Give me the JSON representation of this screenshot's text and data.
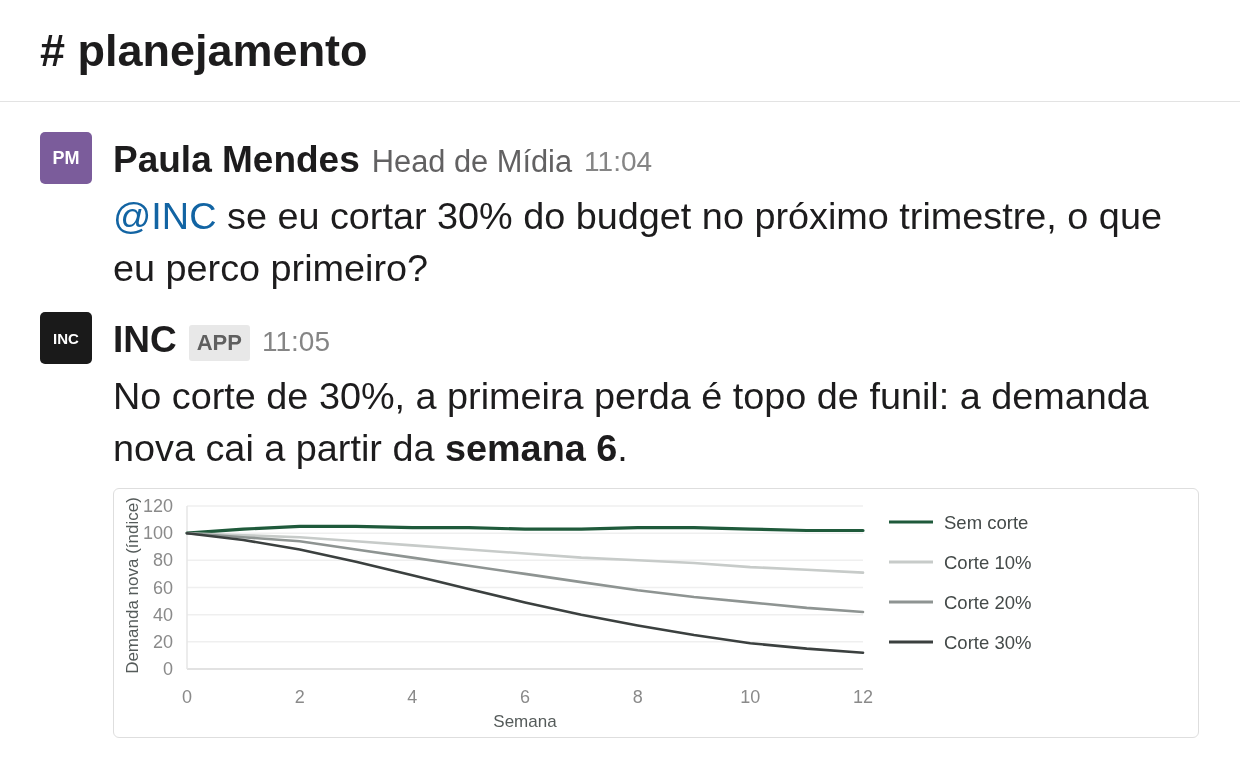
{
  "channel": {
    "title": "# planejamento"
  },
  "messages": [
    {
      "avatar": {
        "initials": "PM",
        "color": "#7b5c9b"
      },
      "author": "Paula Mendes",
      "role": "Head de Mídia",
      "time": "11:04",
      "mention": "@INC",
      "text": "se eu cortar 30% do budget no próximo trimestre, o que eu perco primeiro?"
    },
    {
      "avatar": {
        "initials": "INC",
        "color": "#1a1a1a"
      },
      "author": "INC",
      "badge": "APP",
      "time": "11:05",
      "text": "No corte de 30%, a primeira perda é topo de funil: a demanda nova cai a partir da **semana 6**.",
      "attachment": {
        "chart_data": {
          "type": "line",
          "xlabel": "Semana",
          "ylabel": "Demanda nova (índice)",
          "x": [
            0,
            1,
            2,
            3,
            4,
            5,
            6,
            7,
            8,
            9,
            10,
            11,
            12
          ],
          "xlim": [
            0,
            12
          ],
          "ylim": [
            0,
            120
          ],
          "xticks": [
            0,
            2,
            4,
            6,
            8,
            10,
            12
          ],
          "yticks": [
            0,
            20,
            40,
            60,
            80,
            100,
            120
          ],
          "grid": true,
          "legend": true,
          "series": [
            {
              "name": "Sem corte",
              "color": "#1f5a3b",
              "values": [
                100,
                103,
                105,
                105,
                104,
                104,
                103,
                103,
                104,
                104,
                103,
                102,
                102
              ]
            },
            {
              "name": "Corte 10%",
              "color": "#c7cbc9",
              "values": [
                100,
                98.5,
                97,
                94,
                91,
                88,
                85,
                82,
                80,
                78,
                75,
                73,
                71
              ]
            },
            {
              "name": "Corte 20%",
              "color": "#8e9492",
              "values": [
                100,
                97,
                94,
                88,
                82,
                76,
                70,
                64,
                58,
                53,
                49,
                45,
                42
              ]
            },
            {
              "name": "Corte 30%",
              "color": "#3b403f",
              "values": [
                100,
                95,
                88,
                79,
                69,
                59,
                49,
                40,
                32,
                25,
                19,
                15,
                12
              ]
            }
          ]
        }
      }
    }
  ]
}
